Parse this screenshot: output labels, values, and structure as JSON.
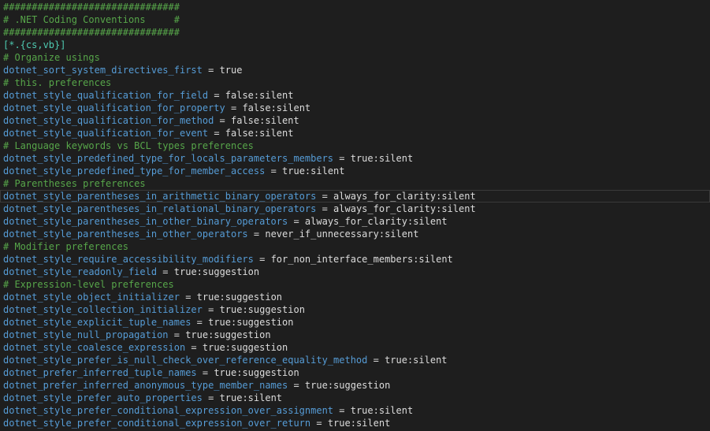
{
  "editor": {
    "lines": [
      {
        "type": "comment",
        "text": "###############################"
      },
      {
        "type": "comment",
        "text": "# .NET Coding Conventions     #"
      },
      {
        "type": "comment",
        "text": "###############################"
      },
      {
        "type": "section",
        "text": "[*.{cs,vb}]"
      },
      {
        "type": "comment",
        "text": "# Organize usings"
      },
      {
        "type": "kv",
        "key": "dotnet_sort_system_directives_first",
        "eq": " = ",
        "value": "true"
      },
      {
        "type": "comment",
        "text": "# this. preferences"
      },
      {
        "type": "kv",
        "key": "dotnet_style_qualification_for_field",
        "eq": " = ",
        "value": "false:silent"
      },
      {
        "type": "kv",
        "key": "dotnet_style_qualification_for_property",
        "eq": " = ",
        "value": "false:silent"
      },
      {
        "type": "kv",
        "key": "dotnet_style_qualification_for_method",
        "eq": " = ",
        "value": "false:silent"
      },
      {
        "type": "kv",
        "key": "dotnet_style_qualification_for_event",
        "eq": " = ",
        "value": "false:silent"
      },
      {
        "type": "comment",
        "text": "# Language keywords vs BCL types preferences"
      },
      {
        "type": "kv",
        "key": "dotnet_style_predefined_type_for_locals_parameters_members",
        "eq": " = ",
        "value": "true:silent"
      },
      {
        "type": "kv",
        "key": "dotnet_style_predefined_type_for_member_access",
        "eq": " = ",
        "value": "true:silent"
      },
      {
        "type": "comment",
        "text": "# Parentheses preferences"
      },
      {
        "type": "kv",
        "key": "dotnet_style_parentheses_in_arithmetic_binary_operators",
        "eq": " = ",
        "value": "always_for_clarity:silent",
        "current": true
      },
      {
        "type": "kv",
        "key": "dotnet_style_parentheses_in_relational_binary_operators",
        "eq": " = ",
        "value": "always_for_clarity:silent"
      },
      {
        "type": "kv",
        "key": "dotnet_style_parentheses_in_other_binary_operators",
        "eq": " = ",
        "value": "always_for_clarity:silent"
      },
      {
        "type": "kv",
        "key": "dotnet_style_parentheses_in_other_operators",
        "eq": " = ",
        "value": "never_if_unnecessary:silent"
      },
      {
        "type": "comment",
        "text": "# Modifier preferences"
      },
      {
        "type": "kv",
        "key": "dotnet_style_require_accessibility_modifiers",
        "eq": " = ",
        "value": "for_non_interface_members:silent"
      },
      {
        "type": "kv",
        "key": "dotnet_style_readonly_field",
        "eq": " = ",
        "value": "true:suggestion"
      },
      {
        "type": "comment",
        "text": "# Expression-level preferences"
      },
      {
        "type": "kv",
        "key": "dotnet_style_object_initializer",
        "eq": " = ",
        "value": "true:suggestion"
      },
      {
        "type": "kv",
        "key": "dotnet_style_collection_initializer",
        "eq": " = ",
        "value": "true:suggestion"
      },
      {
        "type": "kv",
        "key": "dotnet_style_explicit_tuple_names",
        "eq": " = ",
        "value": "true:suggestion"
      },
      {
        "type": "kv",
        "key": "dotnet_style_null_propagation",
        "eq": " = ",
        "value": "true:suggestion"
      },
      {
        "type": "kv",
        "key": "dotnet_style_coalesce_expression",
        "eq": " = ",
        "value": "true:suggestion"
      },
      {
        "type": "kv",
        "key": "dotnet_style_prefer_is_null_check_over_reference_equality_method",
        "eq": " = ",
        "value": "true:silent"
      },
      {
        "type": "kv",
        "key": "dotnet_prefer_inferred_tuple_names",
        "eq": " = ",
        "value": "true:suggestion"
      },
      {
        "type": "kv",
        "key": "dotnet_prefer_inferred_anonymous_type_member_names",
        "eq": " = ",
        "value": "true:suggestion"
      },
      {
        "type": "kv",
        "key": "dotnet_style_prefer_auto_properties",
        "eq": " = ",
        "value": "true:silent"
      },
      {
        "type": "kv",
        "key": "dotnet_style_prefer_conditional_expression_over_assignment",
        "eq": " = ",
        "value": "true:silent"
      },
      {
        "type": "kv",
        "key": "dotnet_style_prefer_conditional_expression_over_return",
        "eq": " = ",
        "value": "true:silent"
      }
    ]
  },
  "colors": {
    "background": "#1e1e1e",
    "comment": "#57a64a",
    "section": "#4ec9b0",
    "key": "#569cd6",
    "value": "#dcdcdc"
  }
}
